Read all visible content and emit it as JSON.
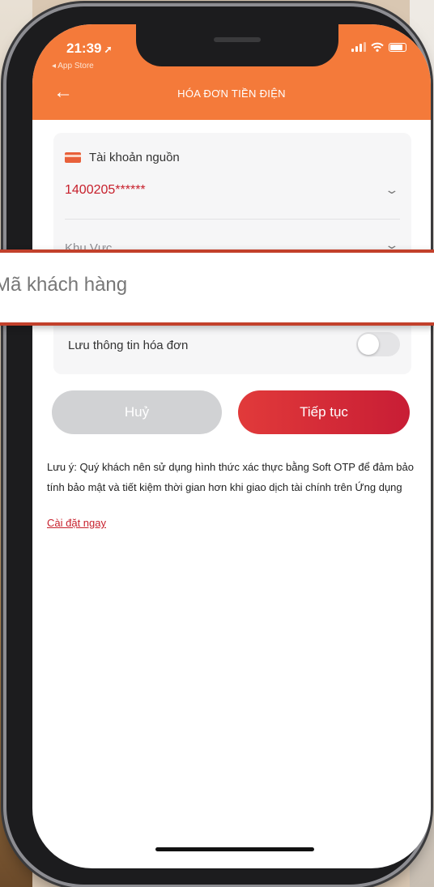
{
  "status_bar": {
    "time": "21:39",
    "back_to_app": "◂ App Store"
  },
  "header": {
    "title": "HÓA ĐƠN TIỀN ĐIỆN",
    "back_icon": "back-arrow-icon"
  },
  "form": {
    "source_account_label": "Tài khoản nguồn",
    "source_account_value": "1400205******",
    "region_placeholder": "Khu Vực",
    "customer_code_placeholder": "Mã khách hàng",
    "save_invoice_label": "Lưu thông tin hóa đơn",
    "save_invoice_enabled": false
  },
  "buttons": {
    "cancel": "Huỷ",
    "next": "Tiếp tục"
  },
  "note": {
    "text": "Lưu ý: Quý khách nên sử dụng hình thức xác thực bằng Soft OTP để đảm bảo tính bảo mật và tiết kiệm thời gian hơn khi giao dịch tài chính trên Ứng dụng",
    "link": "Cài đặt ngay"
  },
  "colors": {
    "header": "#f47a3a",
    "primary_button": "#d32a37",
    "disabled_button": "#d1d2d4",
    "link": "#c7202c"
  }
}
